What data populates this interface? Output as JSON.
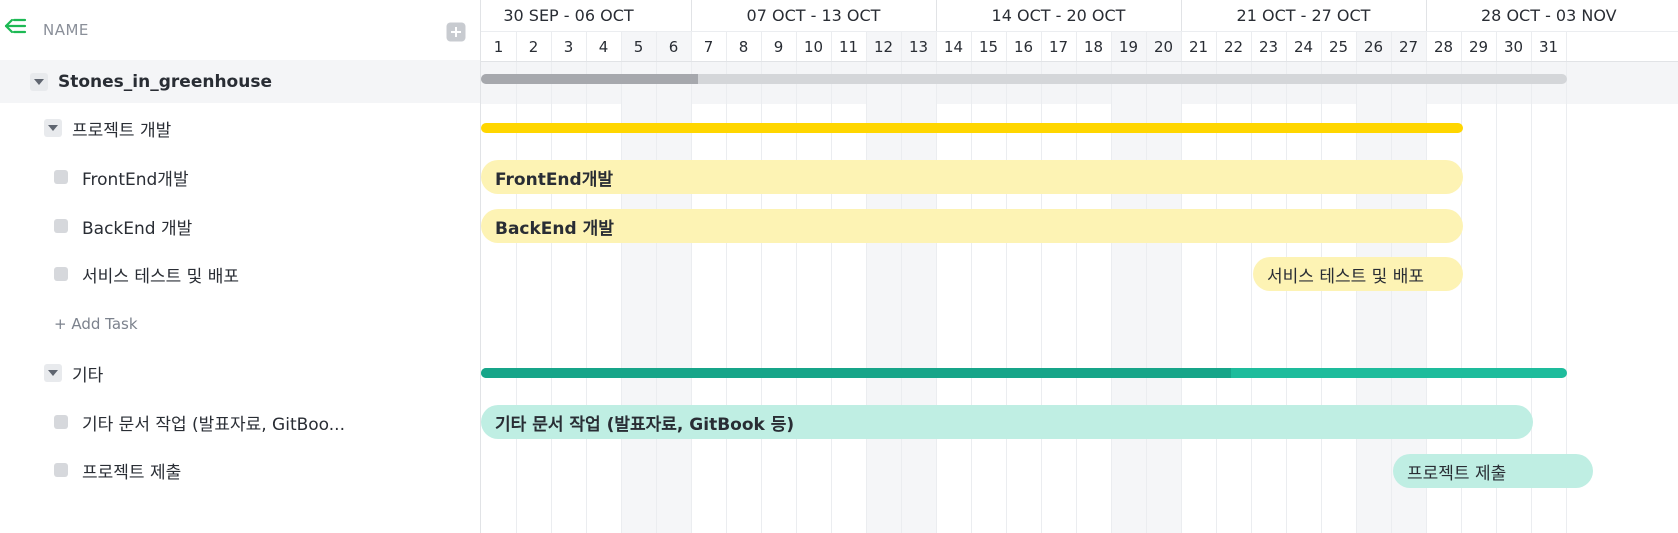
{
  "header": {
    "name_label": "NAME"
  },
  "project": {
    "name": "Stones_in_greenhouse"
  },
  "groups": [
    {
      "name": "프로젝트 개발",
      "tasks": [
        "FrontEnd개발",
        "BackEnd 개발",
        "서비스 테스트 및 배포"
      ],
      "add_task": "+ Add Task"
    },
    {
      "name": "기타",
      "tasks": [
        "기타 문서 작업 (발표자료, GitBoo...",
        "프로젝트 제출"
      ]
    }
  ],
  "weeks": [
    "30 SEP - 06 OCT",
    "07 OCT - 13 OCT",
    "14 OCT - 20 OCT",
    "21 OCT - 27 OCT",
    "28 OCT - 03 NOV"
  ],
  "days": [
    "1",
    "2",
    "3",
    "4",
    "5",
    "6",
    "7",
    "8",
    "9",
    "10",
    "11",
    "12",
    "13",
    "14",
    "15",
    "16",
    "17",
    "18",
    "19",
    "20",
    "21",
    "22",
    "23",
    "24",
    "25",
    "26",
    "27",
    "28",
    "29",
    "30",
    "31"
  ],
  "bars": {
    "frontend": "FrontEnd개발",
    "backend": "BackEnd 개발",
    "service": "서비스 테스트 및 배포",
    "docs": "기타 문서 작업 (발표자료, GitBook 등)",
    "submit": "프로젝트 제출"
  },
  "colors": {
    "accent": "#1db954",
    "dev_group": "#ffd600",
    "dev_task": "#fdf3b4",
    "etc_group_done": "#17a589",
    "etc_group": "#1ebc9c",
    "etc_task": "#bfeee3",
    "progress_done": "#a6a8ad",
    "progress": "#d4d6d9"
  },
  "project_progress": 0.2
}
